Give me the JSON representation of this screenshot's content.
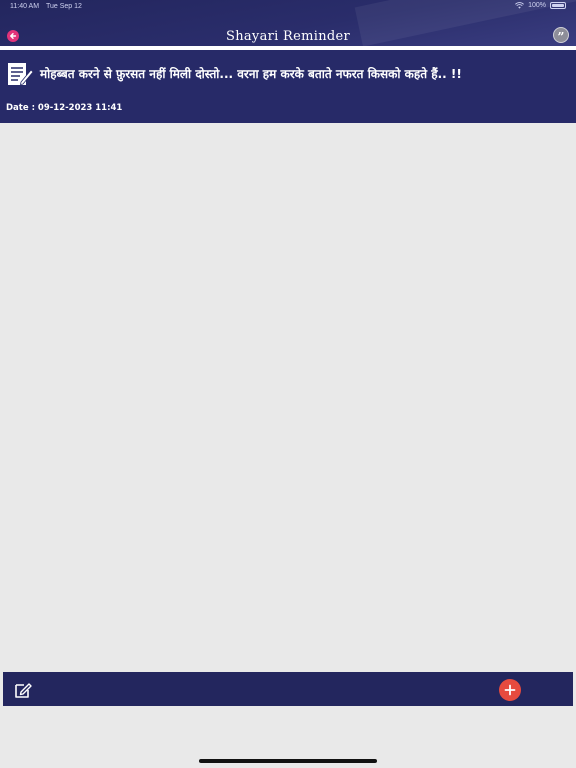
{
  "status_bar": {
    "time": "11:40 AM",
    "date": "Tue Sep 12",
    "battery": "100%"
  },
  "header": {
    "title": "Shayari Reminder",
    "back_icon": "back-arrow-icon",
    "quote_icon": "quote-icon",
    "quote_glyph": "”"
  },
  "shayari": {
    "text": "मोहब्बत करने से फ़ुरसत नहीं मिली दोस्तो... वरना हम करके बताते नफरत किसको कहते हैं.. !!",
    "date": "Date : 09-12-2023 11:41",
    "icon": "note-pencil-icon"
  },
  "toolbar": {
    "edit_icon": "edit-icon",
    "add_icon": "plus-icon"
  },
  "colors": {
    "header_bg": "#23265e",
    "card_bg": "#272a68",
    "page_bg": "#e9e9e9",
    "accent_pink": "#e2337a",
    "add_button": "#e64a3e"
  }
}
